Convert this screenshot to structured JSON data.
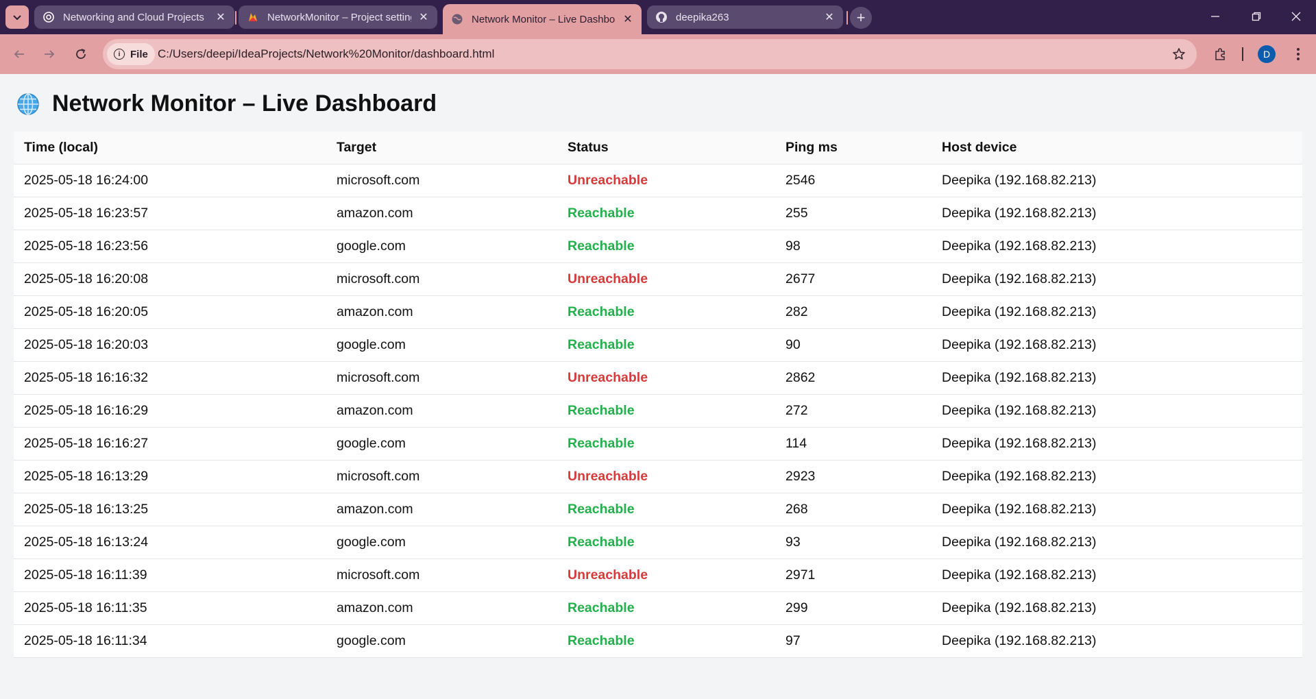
{
  "browser": {
    "tabs": [
      {
        "title": "Networking and Cloud Projects",
        "active": false
      },
      {
        "title": "NetworkMonitor – Project settings",
        "active": false
      },
      {
        "title": "Network Monitor – Live Dashboard",
        "active": true
      },
      {
        "title": "deepika263",
        "active": false
      }
    ],
    "file_chip": "File",
    "url": "C:/Users/deepi/IdeaProjects/Network%20Monitor/dashboard.html",
    "profile_initial": "D"
  },
  "page": {
    "title": "Network Monitor – Live Dashboard",
    "columns": [
      "Time (local)",
      "Target",
      "Status",
      "Ping ms",
      "Host device"
    ],
    "rows": [
      {
        "time": "2025-05-18 16:24:00",
        "target": "microsoft.com",
        "status": "Unreachable",
        "ping": "2546",
        "host": "Deepika (192.168.82.213)"
      },
      {
        "time": "2025-05-18 16:23:57",
        "target": "amazon.com",
        "status": "Reachable",
        "ping": "255",
        "host": "Deepika (192.168.82.213)"
      },
      {
        "time": "2025-05-18 16:23:56",
        "target": "google.com",
        "status": "Reachable",
        "ping": "98",
        "host": "Deepika (192.168.82.213)"
      },
      {
        "time": "2025-05-18 16:20:08",
        "target": "microsoft.com",
        "status": "Unreachable",
        "ping": "2677",
        "host": "Deepika (192.168.82.213)"
      },
      {
        "time": "2025-05-18 16:20:05",
        "target": "amazon.com",
        "status": "Reachable",
        "ping": "282",
        "host": "Deepika (192.168.82.213)"
      },
      {
        "time": "2025-05-18 16:20:03",
        "target": "google.com",
        "status": "Reachable",
        "ping": "90",
        "host": "Deepika (192.168.82.213)"
      },
      {
        "time": "2025-05-18 16:16:32",
        "target": "microsoft.com",
        "status": "Unreachable",
        "ping": "2862",
        "host": "Deepika (192.168.82.213)"
      },
      {
        "time": "2025-05-18 16:16:29",
        "target": "amazon.com",
        "status": "Reachable",
        "ping": "272",
        "host": "Deepika (192.168.82.213)"
      },
      {
        "time": "2025-05-18 16:16:27",
        "target": "google.com",
        "status": "Reachable",
        "ping": "114",
        "host": "Deepika (192.168.82.213)"
      },
      {
        "time": "2025-05-18 16:13:29",
        "target": "microsoft.com",
        "status": "Unreachable",
        "ping": "2923",
        "host": "Deepika (192.168.82.213)"
      },
      {
        "time": "2025-05-18 16:13:25",
        "target": "amazon.com",
        "status": "Reachable",
        "ping": "268",
        "host": "Deepika (192.168.82.213)"
      },
      {
        "time": "2025-05-18 16:13:24",
        "target": "google.com",
        "status": "Reachable",
        "ping": "93",
        "host": "Deepika (192.168.82.213)"
      },
      {
        "time": "2025-05-18 16:11:39",
        "target": "microsoft.com",
        "status": "Unreachable",
        "ping": "2971",
        "host": "Deepika (192.168.82.213)"
      },
      {
        "time": "2025-05-18 16:11:35",
        "target": "amazon.com",
        "status": "Reachable",
        "ping": "299",
        "host": "Deepika (192.168.82.213)"
      },
      {
        "time": "2025-05-18 16:11:34",
        "target": "google.com",
        "status": "Reachable",
        "ping": "97",
        "host": "Deepika (192.168.82.213)"
      }
    ]
  },
  "colors": {
    "unreachable": "#d73a3a",
    "reachable": "#22b04b",
    "browser_frame": "#33204a",
    "browser_accent": "#e3a0a3"
  }
}
